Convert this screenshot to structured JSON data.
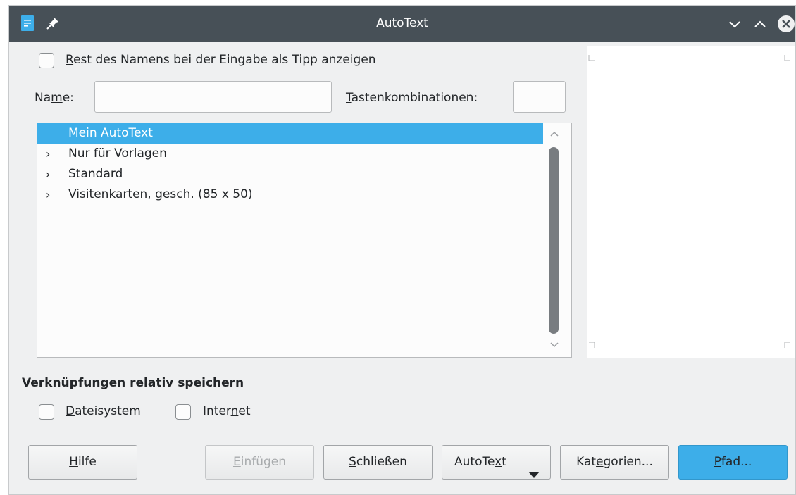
{
  "window": {
    "title": "AutoText"
  },
  "titlebar_icons": [
    "document-icon",
    "pin-icon",
    "minimize-icon",
    "maximize-icon",
    "close-icon"
  ],
  "options": {
    "show_tip": {
      "pre": "",
      "mnemonic": "R",
      "post": "est des Namens bei der Eingabe als Tipp anzeigen",
      "checked": false
    }
  },
  "name_field": {
    "label_pre": "Na",
    "label_mnemonic": "m",
    "label_post": "e:",
    "value": ""
  },
  "shortcut_field": {
    "label_pre": "",
    "label_mnemonic": "T",
    "label_post": "astenkombinationen:",
    "value": ""
  },
  "tree": {
    "items": [
      {
        "label": "Mein AutoText",
        "expandable": false,
        "selected": true
      },
      {
        "label": "Nur für Vorlagen",
        "expandable": true,
        "selected": false
      },
      {
        "label": "Standard",
        "expandable": true,
        "selected": false
      },
      {
        "label": "Visitenkarten, gesch. (85 x 50)",
        "expandable": true,
        "selected": false
      }
    ]
  },
  "relative": {
    "heading": "Verknüpfungen relativ speichern",
    "filesystem": {
      "pre": "",
      "mnemonic": "D",
      "post": "ateisystem",
      "checked": false
    },
    "internet": {
      "pre": "Inter",
      "mnemonic": "n",
      "post": "et",
      "checked": false
    }
  },
  "buttons": {
    "help": {
      "pre": "",
      "mnemonic": "H",
      "post": "ilfe"
    },
    "insert": {
      "pre": "",
      "mnemonic": "E",
      "post": "infügen",
      "disabled": true
    },
    "close": {
      "pre": "",
      "mnemonic": "S",
      "post": "chließen"
    },
    "autotext": {
      "pre": "AutoTe",
      "mnemonic": "x",
      "post": "t"
    },
    "categories": {
      "pre": "Kat",
      "mnemonic": "e",
      "post": "gorien..."
    },
    "path": {
      "pre": "",
      "mnemonic": "P",
      "post": "fad..."
    }
  },
  "colors": {
    "titlebar": "#475057",
    "accent": "#3daee9",
    "dialog_bg": "#eff0f1",
    "field_bg": "#fcfcfc"
  }
}
